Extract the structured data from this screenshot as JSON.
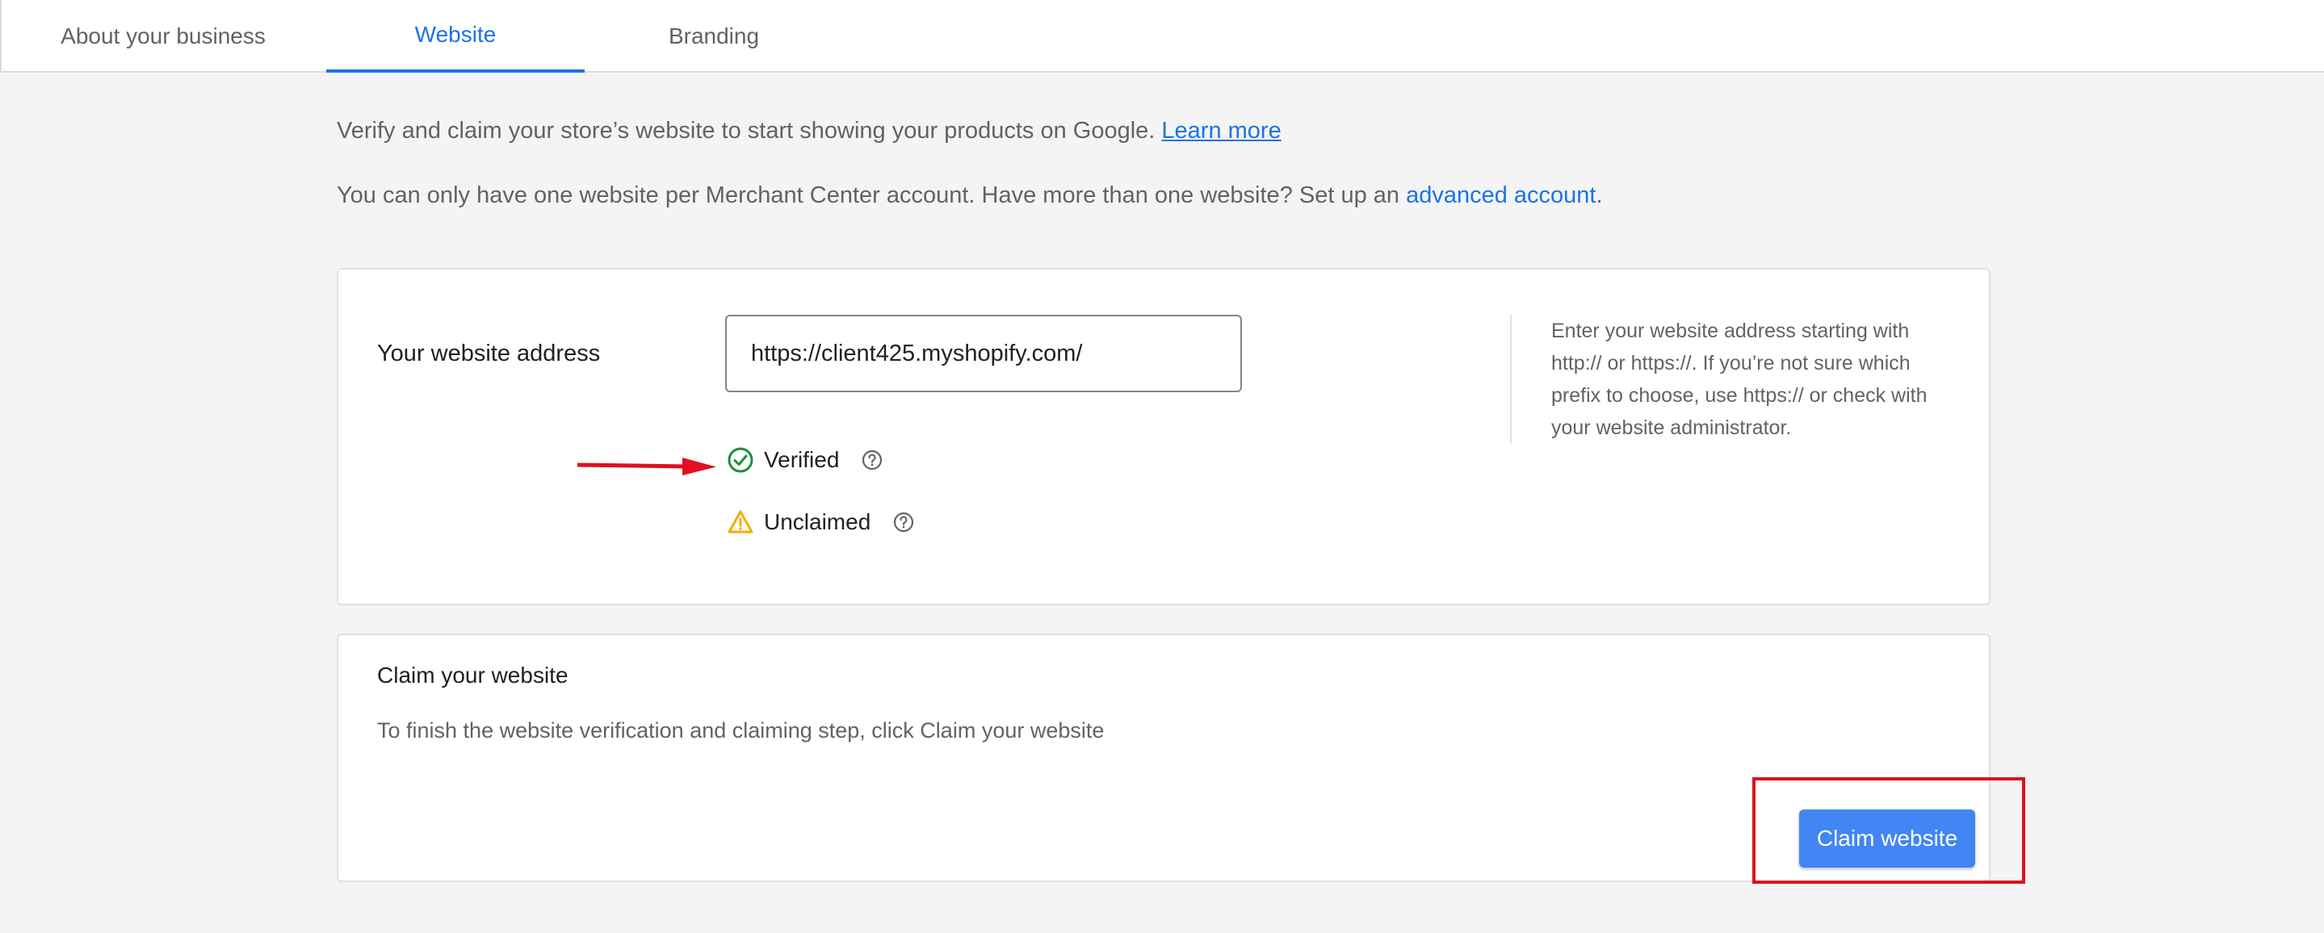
{
  "tabs": [
    {
      "label": "About your business",
      "active": false
    },
    {
      "label": "Website",
      "active": true
    },
    {
      "label": "Branding",
      "active": false
    }
  ],
  "intro": {
    "line1_text": "Verify and claim your store’s website to start showing your products on Google. ",
    "line1_link": "Learn more",
    "line2_text": "You can only have one website per Merchant Center account. Have more than one website? Set up an ",
    "line2_link": "advanced account",
    "line2_suffix": "."
  },
  "website_card": {
    "label": "Your website address",
    "url_value": "https://client425.myshopify.com/",
    "statuses": [
      {
        "label": "Verified",
        "icon": "check-circle-icon",
        "color": "#1e8e3e"
      },
      {
        "label": "Unclaimed",
        "icon": "warning-triangle-icon",
        "color": "#f9ab00"
      }
    ],
    "hint": "Enter your website address starting with http:// or https://. If you’re not sure which prefix to choose, use https:// or check with your website administrator."
  },
  "claim_card": {
    "title": "Claim your website",
    "description": "To finish the website verification and claiming step, click Claim your website",
    "button_label": "Claim website"
  },
  "colors": {
    "accent": "#1a73e8",
    "button": "#4285f4",
    "annotation_red": "#e0101e",
    "verified_green": "#1e8e3e",
    "warning_yellow": "#f9ab00"
  }
}
